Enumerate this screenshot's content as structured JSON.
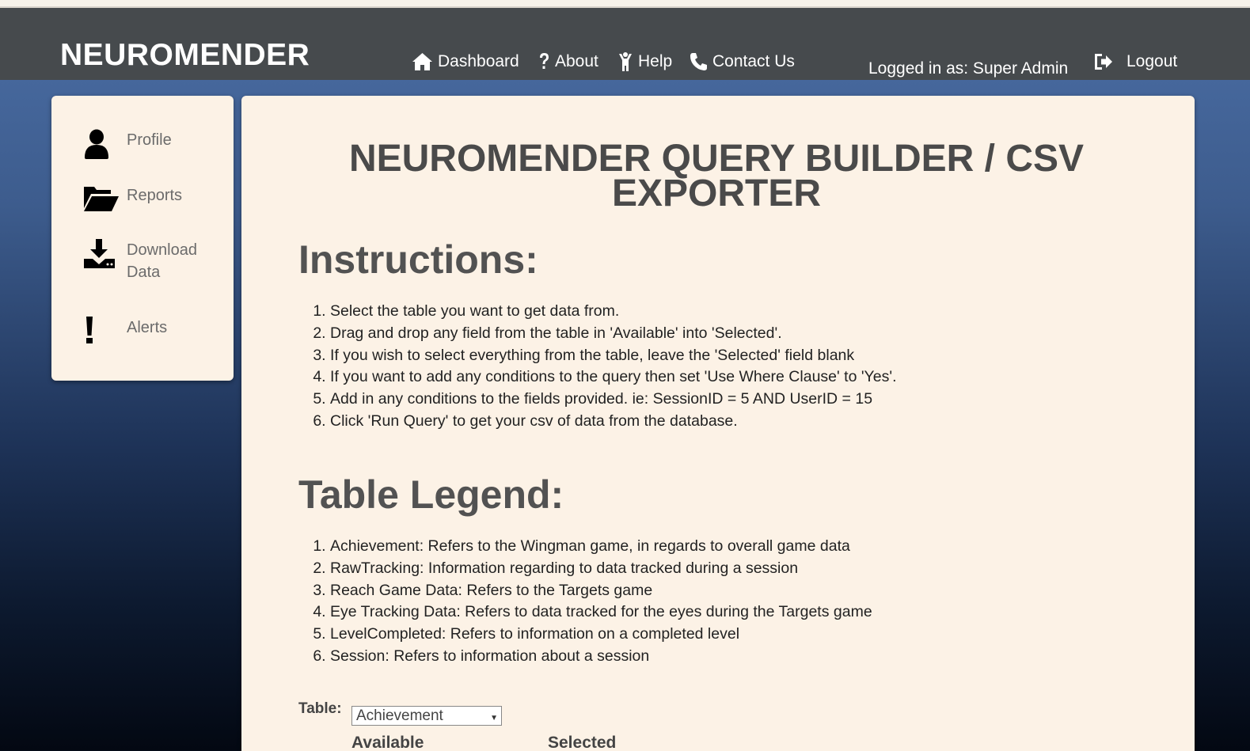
{
  "brand": "NEUROMENDER",
  "nav": {
    "dashboard": "Dashboard",
    "about": "About",
    "help": "Help",
    "contact": "Contact Us",
    "user": "Logged in as: Super Admin",
    "logout": "Logout"
  },
  "sidebar": {
    "items": [
      {
        "label": "Profile",
        "icon": "user-icon"
      },
      {
        "label": "Reports",
        "icon": "folder-open-icon"
      },
      {
        "label": "Download Data",
        "icon": "download-icon"
      },
      {
        "label": "Alerts",
        "icon": "exclamation-icon"
      }
    ]
  },
  "main": {
    "title": "NEUROMENDER QUERY BUILDER / CSV EXPORTER",
    "instructions_heading": "Instructions:",
    "instructions": [
      "Select the table you want to get data from.",
      "Drag and drop any field from the table in 'Available' into 'Selected'.",
      "If you wish to select everything from the table, leave the 'Selected' field blank",
      "If you want to add any conditions to the query then set 'Use Where Clause' to 'Yes'.",
      "Add in any conditions to the fields provided. ie: SessionID = 5 AND UserID = 15",
      "Click 'Run Query' to get your csv of data from the database."
    ],
    "legend_heading": "Table Legend:",
    "legend": [
      "Achievement: Refers to the Wingman game, in regards to overall game data",
      "RawTracking: Information regarding to data tracked during a session",
      "Reach Game Data: Refers to the Targets game",
      "Eye Tracking Data: Refers to data tracked for the eyes during the Targets game",
      "LevelCompleted: Refers to information on a completed level",
      "Session: Refers to information about a session"
    ],
    "table_label": "Table:",
    "table_value": "Achievement",
    "available_label": "Available",
    "selected_label": "Selected"
  },
  "colors": {
    "navbar": "#464a4d",
    "panel": "#fcf2e6",
    "heading": "#4a4a4a"
  }
}
